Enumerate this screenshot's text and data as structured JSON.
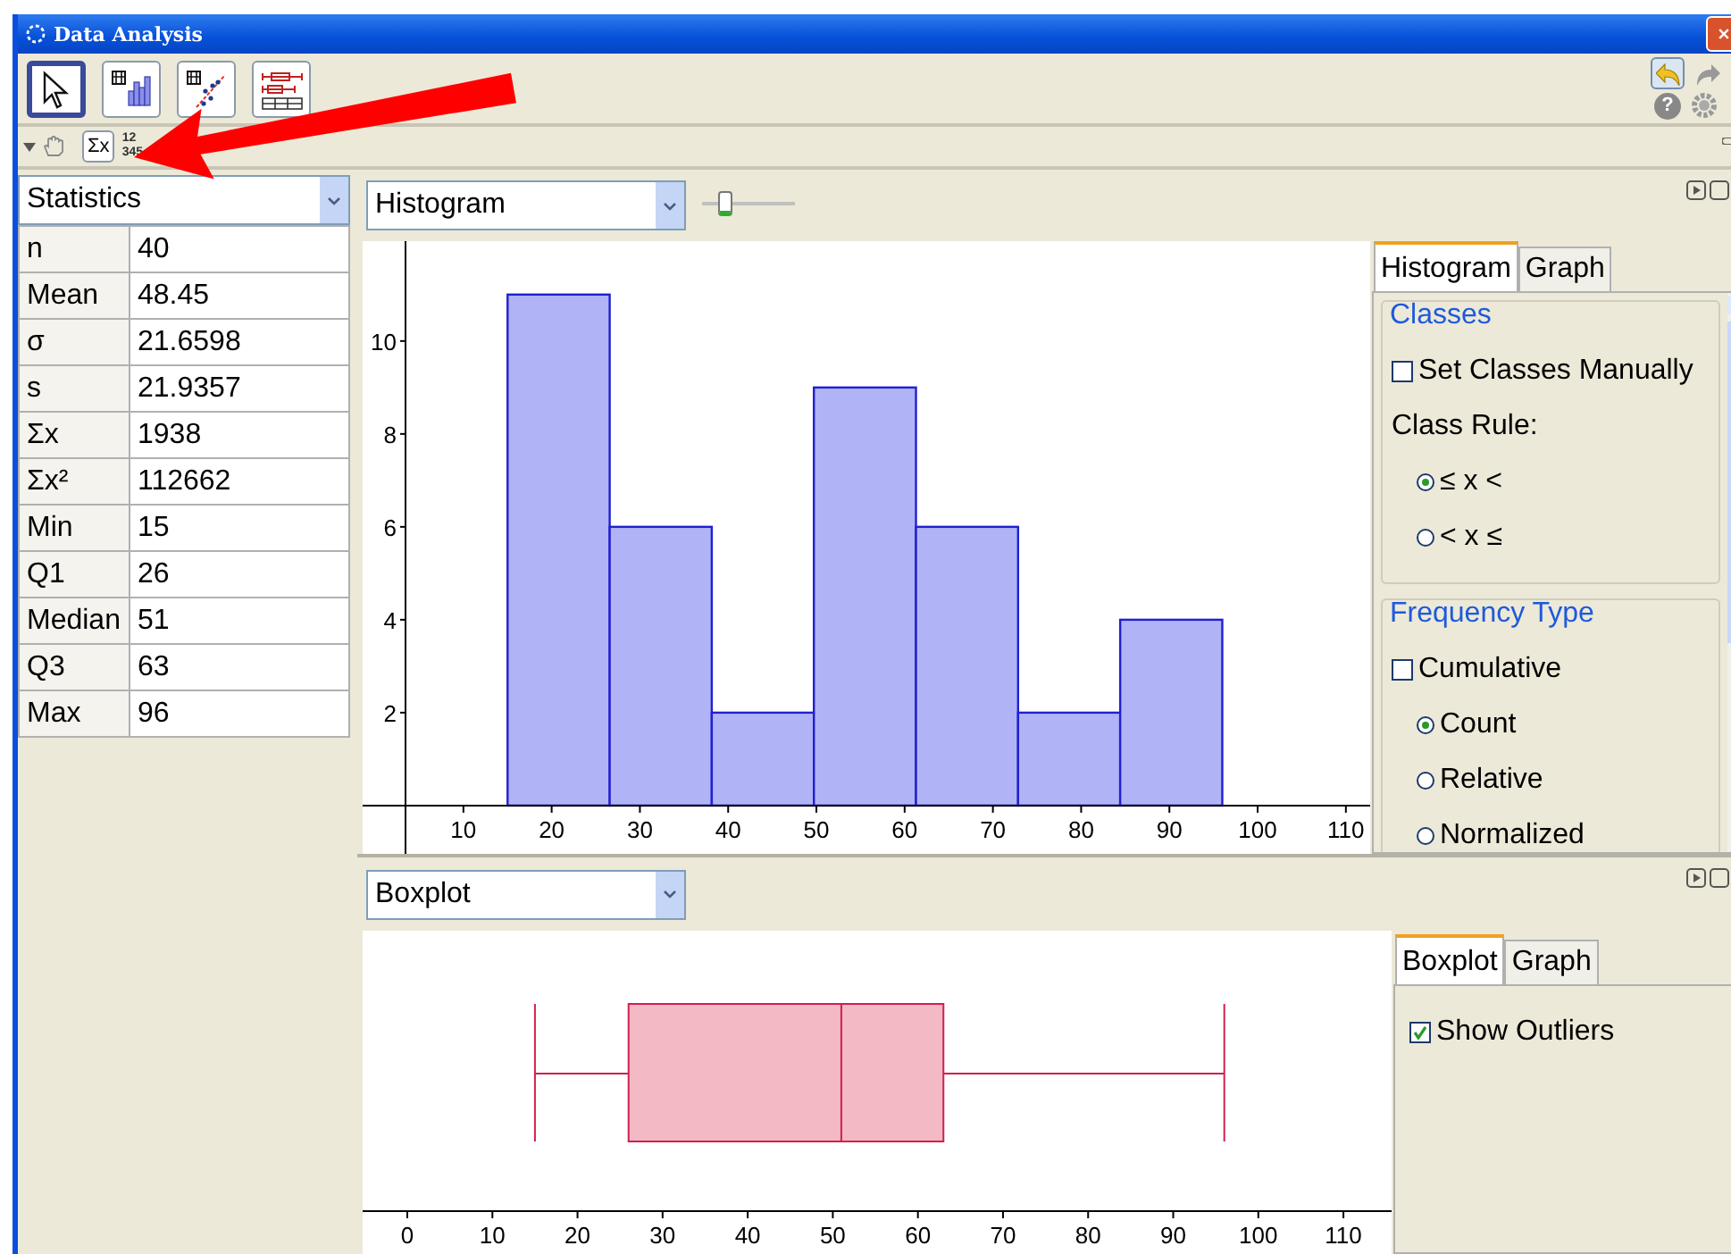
{
  "window": {
    "title": "Data Analysis"
  },
  "toolbar": {
    "tools": [
      {
        "kind": "pointer",
        "selected": true
      },
      {
        "kind": "histogram",
        "selected": false
      },
      {
        "kind": "scatter",
        "selected": false
      },
      {
        "kind": "boxplot",
        "selected": false
      }
    ],
    "help": "?"
  },
  "subtoolbar": {
    "sum_button": "Σx",
    "number_button": [
      "12",
      "345"
    ]
  },
  "statistics": {
    "dropdown": "Statistics",
    "rows": [
      {
        "label": "n",
        "value": "40"
      },
      {
        "label": "Mean",
        "value": "48.45"
      },
      {
        "label": "σ",
        "value": "21.6598"
      },
      {
        "label": "s",
        "value": "21.9357"
      },
      {
        "label": "Σx",
        "value": "1938"
      },
      {
        "label": "Σx²",
        "value": "112662"
      },
      {
        "label": "Min",
        "value": "15"
      },
      {
        "label": "Q1",
        "value": "26"
      },
      {
        "label": "Median",
        "value": "51"
      },
      {
        "label": "Q3",
        "value": "63"
      },
      {
        "label": "Max",
        "value": "96"
      }
    ]
  },
  "histogram_panel": {
    "dropdown": "Histogram",
    "slider": {
      "level": 0.2
    },
    "chart_data": {
      "type": "bar",
      "x": [
        20.79,
        32.36,
        43.93,
        55.5,
        67.07,
        78.64,
        90.21
      ],
      "values": [
        11,
        6,
        2,
        9,
        6,
        2,
        4
      ],
      "xlim": [
        -1.42,
        112.75
      ],
      "ylim": [
        -1.04,
        12.15
      ],
      "xticks": [
        10,
        20,
        30,
        40,
        50,
        60,
        70,
        80,
        90,
        100,
        110
      ],
      "yticks": [
        2,
        4,
        6,
        8,
        10
      ]
    },
    "settings": {
      "tabs": [
        {
          "label": "Histogram",
          "selected": true
        },
        {
          "label": "Graph",
          "selected": false
        }
      ],
      "groups": [
        {
          "title": "Classes",
          "items": [
            {
              "kind": "checkbox",
              "label": "Set Classes Manually",
              "checked": false
            },
            {
              "kind": "label",
              "label": "Class Rule:"
            },
            {
              "kind": "radio",
              "label": "≤ x <",
              "selected": true
            },
            {
              "kind": "radio",
              "label": "< x ≤",
              "selected": false
            }
          ]
        },
        {
          "title": "Frequency Type",
          "items": [
            {
              "kind": "checkbox",
              "label": "Cumulative",
              "checked": false
            },
            {
              "kind": "radio",
              "label": "Count",
              "selected": true
            },
            {
              "kind": "radio",
              "label": "Relative",
              "selected": false
            },
            {
              "kind": "radio",
              "label": "Normalized",
              "selected": false
            }
          ]
        }
      ]
    }
  },
  "boxplot_panel": {
    "dropdown": "Boxplot",
    "axis_labels": [
      "0",
      "10",
      "20",
      "30",
      "40",
      "50",
      "60",
      "70",
      "80",
      "90",
      "100",
      "110"
    ],
    "settings": {
      "tabs": [
        {
          "label": "Boxplot",
          "selected": true
        },
        {
          "label": "Graph",
          "selected": false
        }
      ],
      "items": [
        {
          "kind": "checkbox",
          "label": "Show Outliers",
          "checked": true
        }
      ]
    }
  }
}
